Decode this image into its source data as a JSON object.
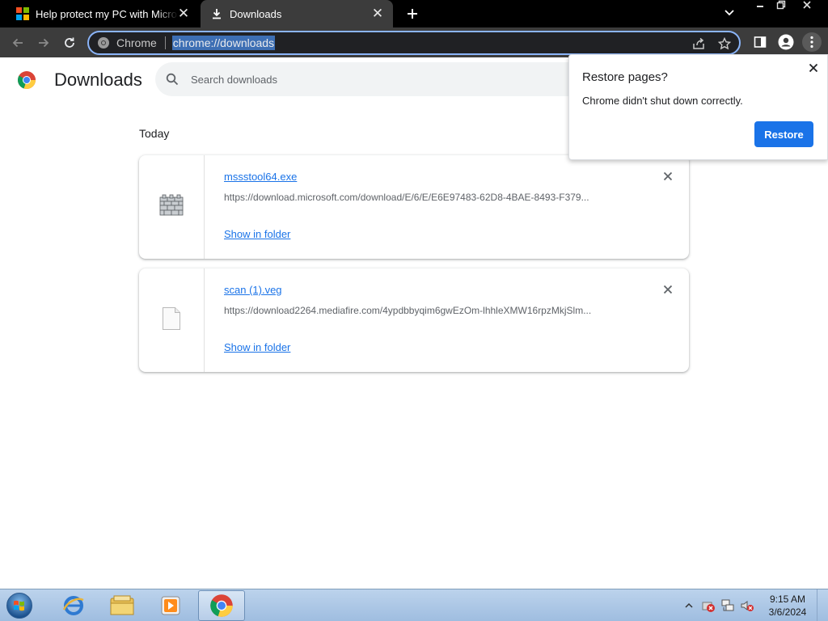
{
  "tabs": [
    {
      "title": "Help protect my PC with Microsoft Defender Offline",
      "icon": "microsoft-logo-icon"
    },
    {
      "title": "Downloads",
      "icon": "download-icon"
    }
  ],
  "omnibox": {
    "chip_label": "Chrome",
    "url": "chrome://downloads"
  },
  "page": {
    "title": "Downloads",
    "search_placeholder": "Search downloads",
    "section_label": "Today"
  },
  "downloads": [
    {
      "filename": "mssstool64.exe",
      "url": "https://download.microsoft.com/download/E/6/E/E6E97483-62D8-4BAE-8493-F379...",
      "action": "Show in folder",
      "icon": "firewall-brick-icon"
    },
    {
      "filename": "scan (1).veg",
      "url": "https://download2264.mediafire.com/4ypdbbyqim6gwEzOm-lhhleXMW16rpzMkjSlm...",
      "action": "Show in folder",
      "icon": "blank-file-icon"
    }
  ],
  "restore_bubble": {
    "title": "Restore pages?",
    "message": "Chrome didn't shut down correctly.",
    "button": "Restore"
  },
  "taskbar": {
    "time": "9:15 AM",
    "date": "3/6/2024"
  },
  "colors": {
    "accent": "#1a73e8",
    "tabstrip": "#000000",
    "toolbar": "#3c3c3c",
    "omnibox_border": "#8ab4f8"
  }
}
